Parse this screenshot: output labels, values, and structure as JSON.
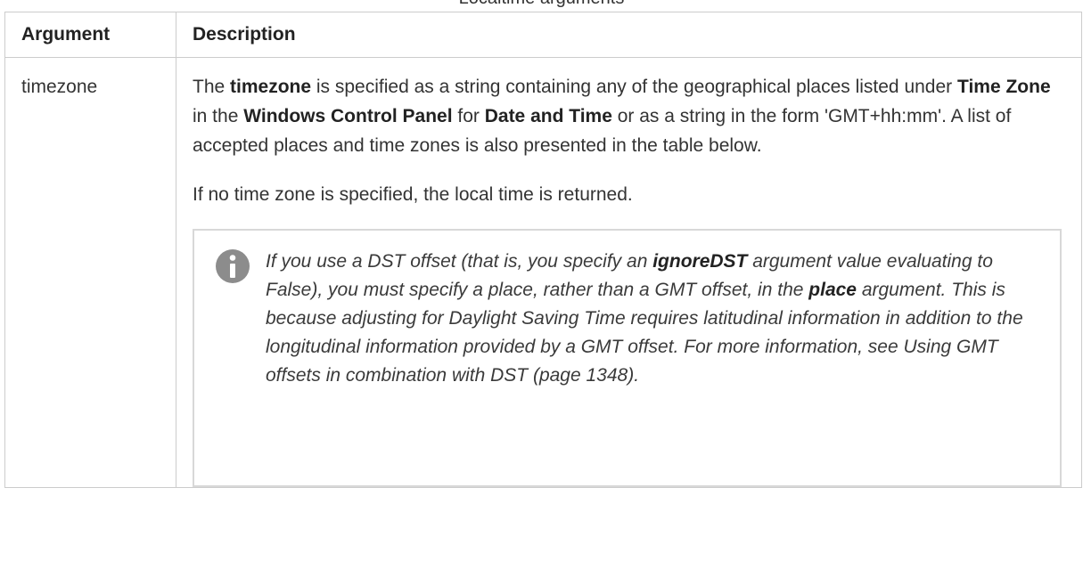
{
  "caption": "Localtime arguments",
  "table": {
    "headers": [
      "Argument",
      "Description"
    ],
    "row": {
      "argument": "timezone",
      "p1": {
        "t1": "The ",
        "b1": "timezone",
        "t2": " is specified as a string containing any of the geographical places listed under ",
        "b2": "Time Zone",
        "t3": " in the ",
        "b3": "Windows Control Panel",
        "t4": " for ",
        "b4": "Date and Time",
        "t5": " or as a string in the form 'GMT+hh:mm'. A list of accepted places and time zones is also presented in the table below."
      },
      "p2": "If no time zone is specified, the local time is returned.",
      "note": {
        "icon": "info-icon",
        "t1": "If you use a DST offset (that is, you specify an ",
        "b1": "ignoreDST",
        "t2": " argument value evaluating to False), you must specify a place, rather than a GMT offset, in the ",
        "b2": "place",
        "t3": " argument. This is because adjusting for Daylight Saving Time requires latitudinal information in addition to the longitudinal information provided by a GMT offset. For more information, see Using GMT offsets in combination with DST (page 1348)."
      }
    }
  },
  "colors": {
    "border": "#cccccc",
    "note_border": "#d8d8d8",
    "icon": "#8c8c8c"
  }
}
